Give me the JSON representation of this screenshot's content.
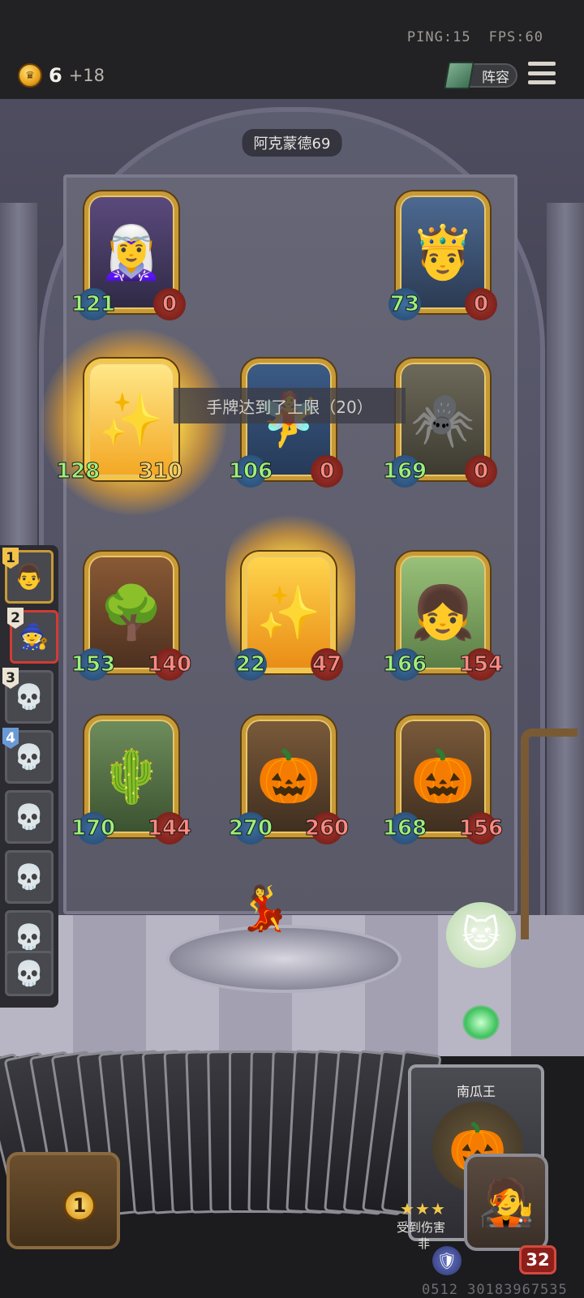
{
  "status": {
    "ping": "PING:15",
    "fps": "FPS:60"
  },
  "gold": {
    "value": "6",
    "income": "+18",
    "icon": "crown-coin-icon"
  },
  "lineup_button": "阵容",
  "opponent_name": "阿克蒙德69",
  "toast": "手牌达到了上限（20）",
  "board": {
    "row1": [
      {
        "name": "elf-sorceress",
        "atk": "121",
        "hp": "0",
        "icon": "🧝‍♀️"
      },
      {
        "name": "king",
        "atk": "73",
        "hp": "0",
        "icon": "🤴"
      }
    ],
    "row2": [
      {
        "name": "glowing-hero",
        "atk": "128",
        "hp": "310",
        "icon": "✨"
      },
      {
        "name": "dryad",
        "atk": "106",
        "hp": "0",
        "icon": "🧚"
      },
      {
        "name": "spider-mushroom",
        "atk": "169",
        "hp": "0",
        "icon": "🕷️"
      }
    ],
    "row3": [
      {
        "name": "treant",
        "atk": "153",
        "hp": "140",
        "icon": "🌳"
      },
      {
        "name": "summoning-hero",
        "atk": "22",
        "hp": "47",
        "icon": "✨"
      },
      {
        "name": "fruit-girl",
        "atk": "166",
        "hp": "154",
        "icon": "👧"
      }
    ],
    "row4": [
      {
        "name": "cactus",
        "atk": "170",
        "hp": "144",
        "icon": "🌵"
      },
      {
        "name": "pumpkin-king-1",
        "atk": "270",
        "hp": "260",
        "icon": "🎃"
      },
      {
        "name": "pumpkin-king-2",
        "atk": "168",
        "hp": "156",
        "icon": "🎃"
      }
    ]
  },
  "roster": [
    {
      "rank": "1",
      "icon": "👨"
    },
    {
      "rank": "2",
      "icon": "🧙"
    },
    {
      "rank": "3",
      "icon": "💀"
    },
    {
      "rank": "4",
      "icon": "💀"
    },
    {
      "rank": "",
      "icon": "💀"
    },
    {
      "rank": "",
      "icon": "💀"
    },
    {
      "rank": "",
      "icon": "💀"
    },
    {
      "rank": "",
      "icon": "💀"
    }
  ],
  "shown_card": {
    "name": "南瓜王",
    "stars": "★★★",
    "desc": "受到伤害",
    "desc2": "非",
    "icon": "🎃"
  },
  "chest_count": "1",
  "player_hp": "32",
  "code": "0512 30183967535",
  "colors": {
    "gold_border": "#c89a36",
    "atk_text": "#9df07a",
    "hp_text": "#ff8a80"
  }
}
